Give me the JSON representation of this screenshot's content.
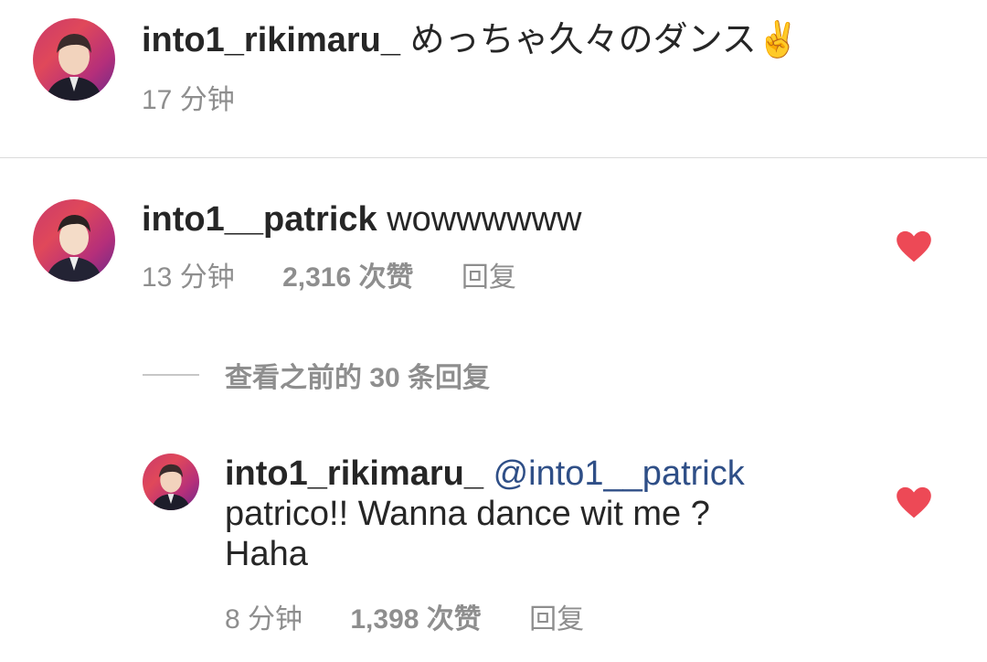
{
  "caption": {
    "username": "into1_rikimaru_",
    "text": "めっちゃ久々のダンス✌️",
    "time": "17 分钟"
  },
  "comment": {
    "username": "into1__patrick",
    "text": "wowwwwww",
    "time": "13 分钟",
    "likes": "2,316 次赞",
    "reply_label": "回复",
    "liked": true
  },
  "view_replies": {
    "label": "查看之前的 30 条回复"
  },
  "reply": {
    "username": "into1_rikimaru_",
    "mention": "@into1__patrick",
    "text_line1": "patrico!! Wanna dance wit me ?",
    "text_line2": "Haha",
    "time": "8 分钟",
    "likes": "1,398 次赞",
    "reply_label": "回复",
    "liked": true
  },
  "colors": {
    "heart": "#ed4956",
    "mention": "#2f4f87",
    "meta": "#8e8e8e",
    "text": "#262626"
  }
}
